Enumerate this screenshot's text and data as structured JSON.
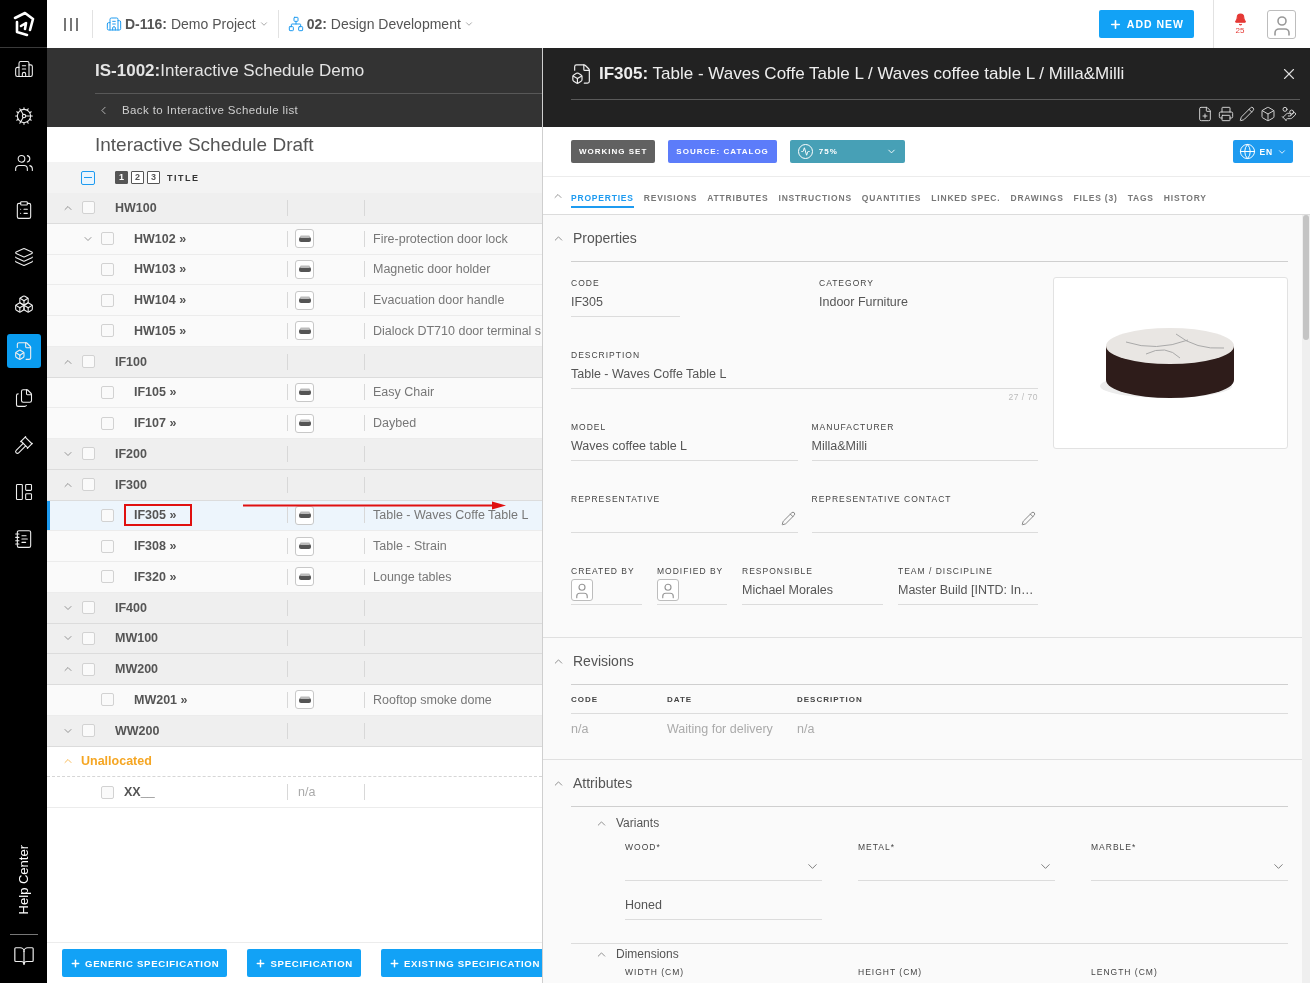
{
  "top_bar": {
    "project": "**D-116:** Demo Project",
    "phase": "**02:** Design Development",
    "add_button": "ADD NEW",
    "notifications": "25"
  },
  "nav": {
    "items": [
      {
        "selected": false
      },
      {
        "selected": false
      },
      {
        "selected": false
      },
      {
        "selected": false
      },
      {
        "selected": false
      },
      {
        "selected": false
      },
      {
        "selected": true
      },
      {
        "selected": false
      },
      {
        "selected": false
      },
      {
        "selected": false
      },
      {
        "selected": false
      }
    ],
    "help": "Help Center"
  },
  "schedule": {
    "title": "**IS-1002:**Interactive Schedule Demo",
    "back_link": "Back to Interactive Schedule list",
    "draft_title": "Interactive Schedule Draft",
    "header": {
      "select_all": {
        "indeterminate": true
      },
      "levels": [
        {
          "label": "1",
          "selected": true
        },
        {
          "label": "2",
          "selected": false
        },
        {
          "label": "3",
          "selected": false
        }
      ],
      "title_column": "TITLE"
    },
    "groups": [
      {
        "kind": "group",
        "code": "HW100",
        "expanded": true,
        "checked": false,
        "items": [
          {
            "code": "HW102 »",
            "expanded": false,
            "checked": false,
            "selected": false,
            "highlighted": false,
            "thumbnail": true,
            "description": "Fire-protection door lock"
          },
          {
            "code": "HW103 »",
            "checked": false,
            "selected": false,
            "highlighted": false,
            "thumbnail": true,
            "description": "Magnetic door holder"
          },
          {
            "code": "HW104 »",
            "checked": false,
            "selected": false,
            "highlighted": false,
            "thumbnail": true,
            "description": "Evacuation door handle"
          },
          {
            "code": "HW105 »",
            "checked": false,
            "selected": false,
            "highlighted": false,
            "thumbnail": true,
            "description": "Dialock DT710 door terminal s"
          }
        ]
      },
      {
        "kind": "group",
        "code": "IF100",
        "expanded": true,
        "checked": false,
        "items": [
          {
            "code": "IF105 »",
            "checked": false,
            "selected": false,
            "highlighted": false,
            "thumbnail": true,
            "description": "Easy Chair"
          },
          {
            "code": "IF107 »",
            "checked": false,
            "selected": false,
            "highlighted": false,
            "thumbnail": true,
            "description": "Daybed"
          }
        ]
      },
      {
        "kind": "group",
        "code": "IF200",
        "expanded": false,
        "checked": false
      },
      {
        "kind": "group",
        "code": "IF300",
        "expanded": true,
        "checked": false,
        "items": [
          {
            "code": "IF305 »",
            "checked": false,
            "selected": true,
            "highlighted": true,
            "thumbnail": true,
            "description": "Table - Waves Coffe Table L"
          },
          {
            "code": "IF308 »",
            "checked": false,
            "selected": false,
            "highlighted": false,
            "thumbnail": true,
            "description": "Table - Strain"
          },
          {
            "code": "IF320 »",
            "checked": false,
            "selected": false,
            "highlighted": false,
            "thumbnail": true,
            "description": "Lounge tables"
          }
        ]
      },
      {
        "kind": "group",
        "code": "IF400",
        "expanded": false,
        "checked": false
      },
      {
        "kind": "group",
        "code": "MW100",
        "expanded": false,
        "checked": false
      },
      {
        "kind": "group",
        "code": "MW200",
        "expanded": true,
        "checked": false,
        "items": [
          {
            "code": "MW201 »",
            "checked": false,
            "selected": false,
            "highlighted": false,
            "thumbnail": true,
            "description": "Rooftop smoke dome"
          }
        ]
      },
      {
        "kind": "group",
        "code": "WW200",
        "expanded": false,
        "checked": false
      },
      {
        "kind": "unallocated",
        "code": "Unallocated",
        "expanded": true,
        "items": [
          {
            "code": "XX__",
            "checked": false,
            "selected": false,
            "highlighted": false,
            "thumbnail": false,
            "column_2": "n/a"
          }
        ]
      }
    ],
    "buttons": [
      "GENERIC SPECIFICATION",
      "SPECIFICATION",
      "EXISTING SPECIFICATION"
    ]
  },
  "detail": {
    "title": "**IF305:** Table - Waves Coffe Table L / Waves coffee table L / Milla&Milli",
    "badges": [
      {
        "kind": "tag",
        "label": "WORKING SET",
        "color": "#616161"
      },
      {
        "kind": "tag",
        "label": "SOURCE: CATALOG",
        "color": "#5c7cfa"
      },
      {
        "kind": "dropdown",
        "label": "75%",
        "color": "#47a0b6"
      }
    ],
    "language": "EN",
    "tabs": [
      {
        "label": "PROPERTIES",
        "selected": true
      },
      {
        "label": "REVISIONS",
        "selected": false
      },
      {
        "label": "ATTRIBUTES",
        "selected": false
      },
      {
        "label": "INSTRUCTIONS",
        "selected": false
      },
      {
        "label": "QUANTITIES",
        "selected": false
      },
      {
        "label": "LINKED SPEC.",
        "selected": false
      },
      {
        "label": "DRAWINGS",
        "selected": false
      },
      {
        "label": "FILES (3)",
        "selected": false
      },
      {
        "label": "TAGS",
        "selected": false
      },
      {
        "label": "HISTORY",
        "selected": false
      }
    ],
    "properties": {
      "title": "Properties",
      "expanded": true,
      "rows": [
        [
          {
            "kind": "text",
            "label": "CODE",
            "value": "IF305"
          },
          {
            "kind": "plain",
            "label": "CATEGORY",
            "value": "Indoor Furniture"
          }
        ],
        [
          {
            "kind": "text",
            "label": "DESCRIPTION",
            "value": "Table - Waves Coffe Table L",
            "counter": "27 / 70"
          }
        ],
        [
          {
            "kind": "text",
            "label": "MODEL",
            "value": "Waves coffee table L"
          },
          {
            "kind": "text",
            "label": "MANUFACTURER",
            "value": "Milla&Milli"
          }
        ],
        [
          {
            "kind": "editable",
            "label": "REPRESENTATIVE"
          },
          {
            "kind": "editable",
            "label": "REPRESENTATIVE CONTACT"
          }
        ],
        [
          {
            "kind": "avatar",
            "label": "CREATED BY"
          },
          {
            "kind": "avatar",
            "label": "MODIFIED BY"
          },
          {
            "kind": "text",
            "label": "RESPONSIBLE",
            "value": "Michael Morales"
          },
          {
            "kind": "text",
            "label": "TEAM / DISCIPLINE",
            "value": "Master Build [INTD: In…"
          }
        ]
      ]
    },
    "revisions": {
      "title": "Revisions",
      "expanded": true,
      "columns": [
        "CODE",
        "DATE",
        "DESCRIPTION"
      ],
      "rows": [
        [
          "n/a",
          "Waiting for delivery",
          "n/a"
        ]
      ]
    },
    "attributes": {
      "title": "Attributes",
      "expanded": true,
      "groups": [
        {
          "title": "Variants",
          "expanded": true,
          "fields": [
            {
              "kind": "select",
              "label": "WOOD*"
            },
            {
              "kind": "select",
              "label": "METAL*"
            },
            {
              "kind": "select",
              "label": "MARBLE*"
            },
            {
              "kind": "text",
              "value": "Honed"
            }
          ]
        },
        {
          "title": "Dimensions",
          "expanded": true,
          "fields": [
            {
              "kind": "label",
              "label": "WIDTH (CM)"
            },
            {
              "kind": "label",
              "label": "HEIGHT (CM)"
            },
            {
              "kind": "label",
              "label": "LENGTH (CM)"
            }
          ]
        }
      ]
    }
  }
}
